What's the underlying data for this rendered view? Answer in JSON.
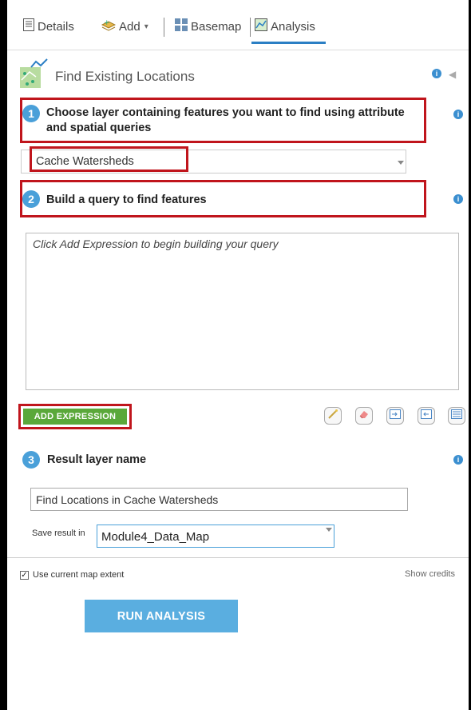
{
  "tabs": [
    {
      "label": "Details",
      "icon": "details-icon"
    },
    {
      "label": "Add",
      "icon": "add-layer-icon"
    },
    {
      "label": "Basemap",
      "icon": "basemap-grid-icon"
    },
    {
      "label": "Analysis",
      "icon": "analysis-icon"
    }
  ],
  "tool": {
    "title": "Find Existing Locations",
    "icon": "find-locations-icon"
  },
  "step1": {
    "number": "1",
    "line1": "Choose layer containing features you want to find using attribute",
    "line2": "and spatial queries",
    "selected_layer": "Cache Watersheds"
  },
  "step2": {
    "number": "2",
    "label": "Build a query to find features",
    "placeholder": "Click Add Expression to begin building your query",
    "add_expression_label": "ADD EXPRESSION"
  },
  "step3": {
    "number": "3",
    "label": "Result layer name",
    "layer_name": "Find Locations in Cache Watersheds",
    "save_label": "Save result in",
    "save_folder": "Module4_Data_Map"
  },
  "footer": {
    "use_extent_label": "Use current map extent",
    "use_extent_checked": true,
    "show_credits": "Show credits",
    "run_label": "RUN ANALYSIS"
  },
  "colors": {
    "accent": "#4aa0d9",
    "highlight": "#c0151c",
    "add_button": "#5aa83a",
    "run_button": "#5aaee0"
  }
}
